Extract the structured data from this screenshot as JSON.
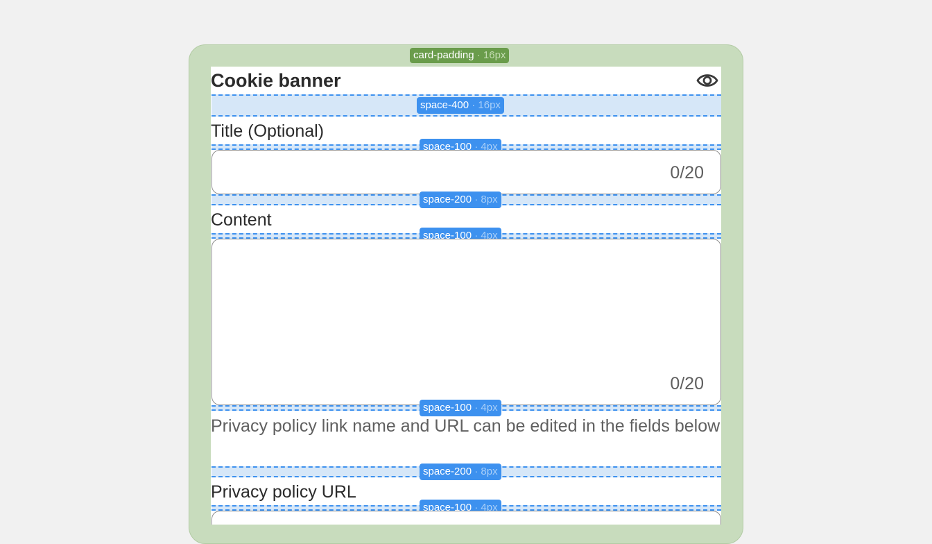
{
  "card": {
    "padding_token": "card-padding",
    "padding_value": "16px",
    "title": "Cookie banner",
    "preview_icon": "eye-icon"
  },
  "spacing": {
    "header_gap": {
      "token": "space-400",
      "value": "16px"
    },
    "title_label_gap": {
      "token": "space-100",
      "value": "4px"
    },
    "title_field_gap": {
      "token": "space-200",
      "value": "8px"
    },
    "content_label_gap": {
      "token": "space-100",
      "value": "4px"
    },
    "content_field_gap": {
      "token": "space-100",
      "value": "4px"
    },
    "helper_gap": {
      "token": "space-200",
      "value": "8px"
    },
    "url_label_gap": {
      "token": "space-100",
      "value": "4px"
    }
  },
  "form": {
    "title_field": {
      "label": "Title (Optional)",
      "value": "",
      "counter": "0/20"
    },
    "content_field": {
      "label": "Content",
      "value": "",
      "counter": "0/20"
    },
    "helper_text": "Privacy policy link name and URL can be edited in the fields below",
    "privacy_url_field": {
      "label": "Privacy policy URL",
      "value": ""
    }
  },
  "colors": {
    "card_background": "#c8dcbd",
    "padding_badge": "#6a9c4b",
    "spacing_accent": "#3d91ef",
    "spacing_fill": "#d6e7f8"
  }
}
